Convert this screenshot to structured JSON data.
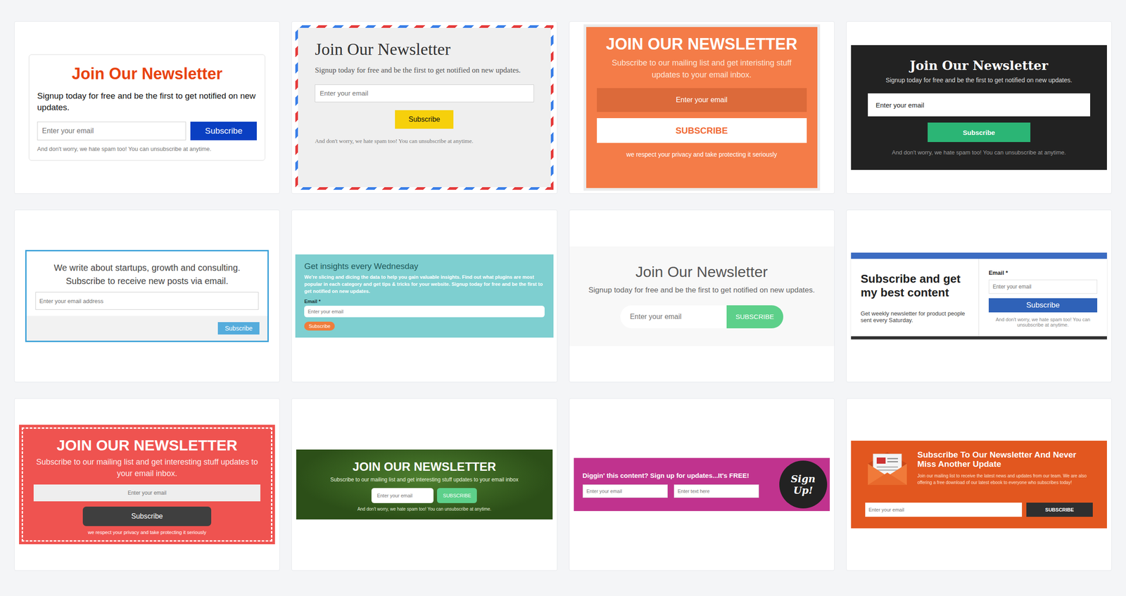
{
  "gallery": {
    "forms": [
      {
        "kind": "classic",
        "title": "Join Our Newsletter",
        "text": "Signup today for free and be the first to get notified on new updates.",
        "placeholder": "Enter your email",
        "button": "Subscribe",
        "note": "And don't worry, we hate spam too! You can unsubscribe at anytime."
      },
      {
        "kind": "airmail",
        "title": "Join Our Newsletter",
        "text": "Signup today for free and be the first to get notified on new updates.",
        "placeholder": "Enter your email",
        "button": "Subscribe",
        "note": "And don't worry, we hate spam too! You can unsubscribe at anytime."
      },
      {
        "kind": "orange",
        "title": "JOIN OUR NEWSLETTER",
        "text": "Subscribe to our mailing list and get interisting stuff updates to your email inbox.",
        "placeholder": "Enter your email",
        "button": "SUBSCRIBE",
        "note": "we respect your privacy and take protecting it seriously"
      },
      {
        "kind": "dark",
        "title": "Join Our Newsletter",
        "text": "Signup today for free and be the first to get notified on new updates.",
        "placeholder": "Enter your email",
        "button": "Subscribe",
        "note": "And don't worry, we hate spam too! You can unsubscribe at anytime."
      },
      {
        "kind": "outline",
        "lines": [
          "We write about startups, growth and consulting.",
          "Subscribe to receive new posts via email."
        ],
        "placeholder": "Enter your email address",
        "button": "Subscribe"
      },
      {
        "kind": "teal",
        "title": "Get insights every Wednesday",
        "text": "We're slicing and dicing the data to help you gain valuable insights. Find out what plugins are most popular in each category and get tips & tricks for your website. Signup today for free and be the first to get notified on new updates.",
        "label": "Email *",
        "placeholder": "Enter your email",
        "button": "Subscribe"
      },
      {
        "kind": "minimal",
        "title": "Join Our Newsletter",
        "text": "Signup today for free and be the first to get notified on new updates.",
        "placeholder": "Enter your email",
        "button": "SUBSCRIBE"
      },
      {
        "kind": "split",
        "title": "Subscribe and get my best content",
        "text": "Get weekly newsletter for product people sent every Saturday.",
        "label": "Email *",
        "placeholder": "Enter your email",
        "button": "Subscribe",
        "note": "And don't worry, we hate spam too! You can unsubscribe at anytime."
      },
      {
        "kind": "red",
        "title": "JOIN OUR NEWSLETTER",
        "text": "Subscribe to our mailing list and get interesting stuff updates to your email inbox.",
        "placeholder": "Enter your email",
        "button": "Subscribe",
        "note": "we respect your privacy and take protecting it seriously"
      },
      {
        "kind": "forest",
        "title": "JOIN OUR NEWSLETTER",
        "text": "Subscribe to our mailing list and get interesting stuff updates to your email inbox",
        "placeholder": "Enter your email",
        "button": "SUBSCRIBE",
        "note": "And don't worry, we hate spam too! You can unsubscribe at anytime."
      },
      {
        "kind": "magenta",
        "text": "Diggin' this content? Sign up for updates...It's FREE!",
        "placeholder": "Enter your email",
        "placeholder2": "Enter text here",
        "badge": "Sign Up!"
      },
      {
        "kind": "envelope",
        "title": "Subscribe To Our Newsletter And Never Miss Another Update",
        "text": "Join our mailing list to receive the latest news and updates from our team. We are also offering a free download of our latest ebook to everyone who subscribes today!",
        "placeholder": "Enter your email",
        "button": "SUBSCRIBE"
      }
    ]
  }
}
